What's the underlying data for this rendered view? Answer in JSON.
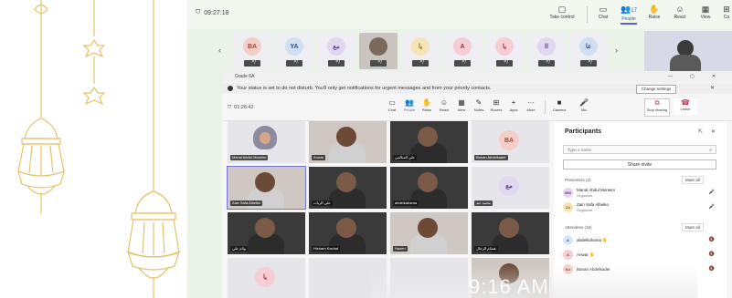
{
  "outer": {
    "timer": "09:27:18",
    "toolbar": [
      {
        "label": "Take control",
        "glyph": "▢",
        "active": false
      },
      {
        "label": "Chat",
        "glyph": "▭",
        "active": false
      },
      {
        "label": "People",
        "glyph": "👥",
        "count": "17",
        "active": true
      },
      {
        "label": "Raise",
        "glyph": "✋",
        "active": false
      },
      {
        "label": "React",
        "glyph": "☺",
        "active": false
      },
      {
        "label": "View",
        "glyph": "▦",
        "active": false
      },
      {
        "label": "Co",
        "glyph": "⊞",
        "active": false
      }
    ],
    "strip_tiles": [
      {
        "initials": "BA",
        "bg": "#f3cfc8",
        "fg": "#9a4a3d",
        "photo": false
      },
      {
        "initials": "YA",
        "bg": "#cfe0f5",
        "fg": "#2b4f86",
        "photo": false
      },
      {
        "initials": "مع",
        "bg": "#e1d7ef",
        "fg": "#5b3f88",
        "photo": false
      },
      {
        "initials": "",
        "bg": "",
        "fg": "",
        "photo": true
      },
      {
        "initials": "يا",
        "bg": "#f6e3b6",
        "fg": "#8a6a1c",
        "photo": false
      },
      {
        "initials": "A",
        "bg": "#f6cdd2",
        "fg": "#9a2d3d",
        "photo": false
      },
      {
        "initials": "يا",
        "bg": "#f6cdd2",
        "fg": "#9a2d3d",
        "photo": false
      },
      {
        "initials": "اا",
        "bg": "#e1d7ef",
        "fg": "#5b3f88",
        "photo": false
      },
      {
        "initials": "عا",
        "bg": "#cfe0f5",
        "fg": "#2b4f86",
        "photo": false
      }
    ],
    "nav_prev": "‹",
    "nav_next": "›"
  },
  "window": {
    "title": "Grade 6A",
    "minimize": "—",
    "maximize": "▢",
    "close": "✕",
    "banner_text": "Your status is set to do not disturb. You'll only get notifications for urgent messages and from your priority contacts.",
    "banner_button": "Change settings",
    "banner_close": "✕",
    "meeting_timer": "01:26:42",
    "shield": "⛉",
    "controls": [
      {
        "label": "Chat",
        "glyph": "▭"
      },
      {
        "label": "People",
        "glyph": "👥",
        "count": "17",
        "active": true
      },
      {
        "label": "Raise",
        "glyph": "✋"
      },
      {
        "label": "React",
        "glyph": "☺"
      },
      {
        "label": "View",
        "glyph": "▦"
      },
      {
        "label": "Notes",
        "glyph": "✎"
      },
      {
        "label": "Rooms",
        "glyph": "⊞"
      },
      {
        "label": "Apps",
        "glyph": "+"
      },
      {
        "label": "More",
        "glyph": "···"
      }
    ],
    "camera_label": "Camera",
    "camera_glyph": "■",
    "mic_label": "Mic",
    "mic_glyph": "🎤",
    "share_label": "Stop sharing",
    "share_glyph": "⧉",
    "leave_label": "Leave",
    "leave_glyph": "☎"
  },
  "grid": [
    {
      "label": "Manal Abdul Moneim",
      "kind": "hijab"
    },
    {
      "label": "Anwar",
      "kind": "photo-light"
    },
    {
      "label": "علي السالمي",
      "kind": "photo"
    },
    {
      "label": "Banan Abdelkader",
      "kind": "avatar",
      "initials": "BA",
      "bg": "#f3cfc8",
      "fg": "#9a4a3d"
    },
    {
      "label": "Zain Safa Albeiko",
      "kind": "photo-light",
      "selected": true
    },
    {
      "label": "علي الزيات",
      "kind": "photo"
    },
    {
      "label": "abdelkahama",
      "kind": "photo"
    },
    {
      "label": "محمد عبد",
      "kind": "avatar",
      "initials": "مع",
      "bg": "#e1d7ef",
      "fg": "#5b3f88"
    },
    {
      "label": "وئام علي",
      "kind": "photo"
    },
    {
      "label": "Hisham Kachaf",
      "kind": "photo"
    },
    {
      "label": "Hazen",
      "kind": "photo-light"
    },
    {
      "label": "هشام الرجال",
      "kind": "photo"
    },
    {
      "label": "",
      "kind": "avatar",
      "initials": "يا",
      "bg": "#f6cdd2",
      "fg": "#9a2d3d"
    },
    {
      "label": "",
      "kind": "grey"
    },
    {
      "label": "",
      "kind": "grey"
    },
    {
      "label": "",
      "kind": "photo-light"
    }
  ],
  "panel": {
    "title": "Participants",
    "pop": "⇱",
    "close": "✕",
    "search_placeholder": "Type a name",
    "search_glyph": "⌕",
    "share_invite": "Share invite",
    "presenters_label": "Presenters (2)",
    "mute_all": "Mute all",
    "presenters": [
      {
        "initials": "MM",
        "bg": "#e6d4ee",
        "fg": "#6b3d86",
        "name": "Manal Abdul Moneim",
        "role": "Organizer",
        "mic": "🎤"
      },
      {
        "initials": "ZA",
        "bg": "#f6e3b6",
        "fg": "#8a6a1c",
        "name": "Zain Safa Albeiko",
        "role": "Organizer",
        "mic": "🎤"
      }
    ],
    "attendees_label": "Attendees (15)",
    "mute_all_2": "Mute all",
    "attendees": [
      {
        "initials": "A",
        "bg": "#d7e6f7",
        "fg": "#2b4f86",
        "name": "abdelkahama ✋",
        "mic": "🔇"
      },
      {
        "initials": "A",
        "bg": "#f6cdd2",
        "fg": "#9a2d3d",
        "name": "Anwar ✋",
        "mic": "🔇"
      },
      {
        "initials": "BA",
        "bg": "#f3cfc8",
        "fg": "#9a4a3d",
        "name": "Banan Abdelkader",
        "mic": "🔇"
      }
    ]
  },
  "clock": "9:16 AM"
}
